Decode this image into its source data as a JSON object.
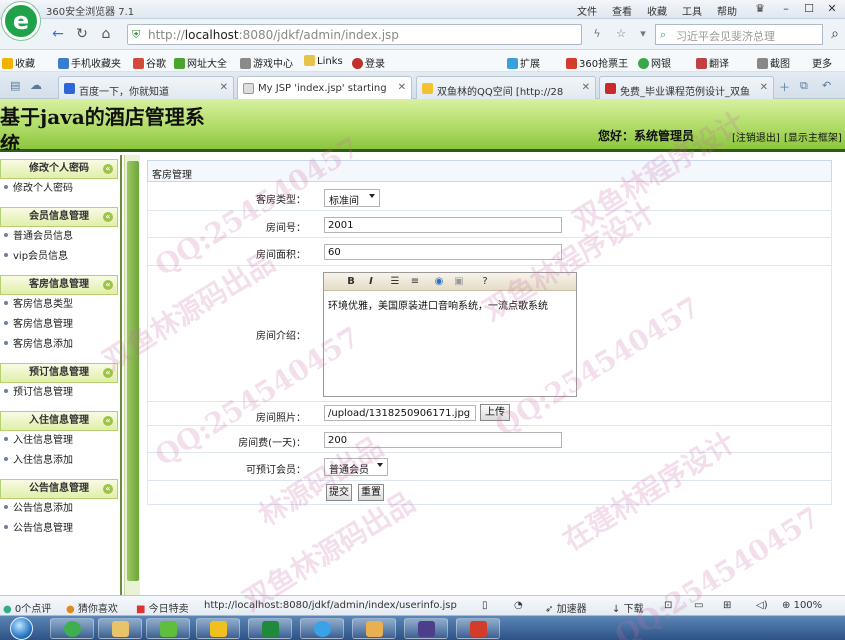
{
  "browser": {
    "app_title": "360安全浏览器 7.1",
    "menu": [
      "文件",
      "查看",
      "收藏",
      "工具",
      "帮助"
    ],
    "url_host": "localhost",
    "url_prefix": "http://",
    "url_rest": ":8080/jdkf/admin/index.jsp",
    "search_placeholder": "习近平会见斐济总理",
    "bookmarks": [
      "收藏",
      "手机收藏夹",
      "谷歌",
      "网址大全",
      "游戏中心",
      "Links",
      "登录"
    ],
    "bookmarks_right": [
      "扩展",
      "360抢票王",
      "网银",
      "翻译",
      "截图",
      "更多"
    ],
    "tabs": [
      {
        "label": "百度一下，你就知道"
      },
      {
        "label": "My JSP 'index.jsp' starting"
      },
      {
        "label": "双鱼林的QQ空间 [http://28"
      },
      {
        "label": "免费_毕业课程范例设计_双鱼"
      }
    ]
  },
  "header": {
    "site_title": "基于java的酒店管理系统",
    "welcome": "您好：系统管理员",
    "logout": "[注销退出]",
    "show_frame": "[显示主框架]"
  },
  "sidebar": {
    "groups": [
      {
        "title": "修改个人密码",
        "items": [
          "修改个人密码"
        ]
      },
      {
        "title": "会员信息管理",
        "items": [
          "普通会员信息",
          "vip会员信息"
        ]
      },
      {
        "title": "客房信息管理",
        "items": [
          "客房信息类型",
          "客房信息管理",
          "客房信息添加"
        ]
      },
      {
        "title": "预订信息管理",
        "items": [
          "预订信息管理"
        ]
      },
      {
        "title": "入住信息管理",
        "items": [
          "入住信息管理",
          "入住信息添加"
        ]
      },
      {
        "title": "公告信息管理",
        "items": [
          "公告信息添加",
          "公告信息管理"
        ]
      }
    ]
  },
  "form": {
    "panel_title": "客房管理",
    "room_type_label": "客房类型：",
    "room_type_value": "标准间",
    "room_no_label": "房间号：",
    "room_no_value": "2001",
    "area_label": "房间面积：",
    "area_value": "60",
    "intro_label": "房间介绍：",
    "intro_value": "环境优雅，美国原装进口音响系统，一流点歌系统",
    "photo_label": "房间照片：",
    "photo_value": "/upload/1318250906171.jpg",
    "upload_label": "上传",
    "fee_label": "房间费(一天)：",
    "fee_value": "200",
    "member_label": "可预订会员：",
    "member_value": "普通会员",
    "submit_label": "提交",
    "reset_label": "重置",
    "editor_tools": [
      "B",
      "I"
    ]
  },
  "statusbar": {
    "items": [
      "0个点评",
      "猜你喜欢",
      "今日特卖"
    ],
    "url": "http://localhost:8080/jdkf/admin/index/userinfo.jsp",
    "accelerator": "加速器",
    "download": "下载",
    "zoom": "100%"
  },
  "watermark": {
    "texts": [
      "QQ:254540457",
      "双鱼林源码出品",
      "双鱼林程序设计",
      "QQ:254540457",
      "林源码出品",
      "QQ:254540457",
      "双鱼林程序设计",
      "在建林程序设计",
      "QQ:254540457",
      "双鱼林源码出品"
    ]
  }
}
